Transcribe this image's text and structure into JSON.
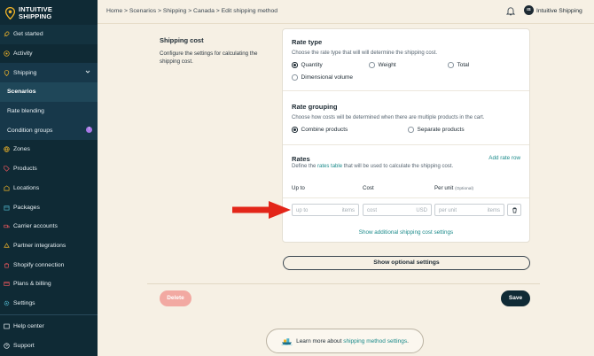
{
  "brand": {
    "line1": "INTUITIVE",
    "line2": "SHIPPING"
  },
  "sidebar": {
    "items": [
      {
        "label": "Get started",
        "icon": "rocket-icon"
      },
      {
        "label": "Activity",
        "icon": "activity-icon"
      },
      {
        "label": "Shipping",
        "icon": "shipping-icon",
        "chevron": "chevron-down-icon"
      },
      {
        "label": "Scenarios"
      },
      {
        "label": "Rate blending"
      },
      {
        "label": "Condition groups",
        "badge": "!"
      },
      {
        "label": "Zones",
        "icon": "globe-icon"
      },
      {
        "label": "Products",
        "icon": "tag-icon"
      },
      {
        "label": "Locations",
        "icon": "location-icon"
      },
      {
        "label": "Packages",
        "icon": "box-icon"
      },
      {
        "label": "Carrier accounts",
        "icon": "carrier-icon"
      },
      {
        "label": "Partner integrations",
        "icon": "integration-icon"
      },
      {
        "label": "Shopify connection",
        "icon": "shopify-icon"
      },
      {
        "label": "Plans & billing",
        "icon": "card-icon"
      },
      {
        "label": "Settings",
        "icon": "gear-icon"
      }
    ],
    "bottom": [
      {
        "label": "Help center",
        "icon": "help-icon"
      },
      {
        "label": "Support",
        "icon": "support-icon"
      }
    ]
  },
  "topbar": {
    "breadcrumb": "Home > Scenarios > Shipping > Canada > Edit shipping method",
    "user_initials": "IS",
    "user_name": "Intuitive Shipping"
  },
  "section": {
    "title": "Shipping cost",
    "description": "Configure the settings for calculating the shipping cost."
  },
  "rate_type": {
    "title": "Rate type",
    "subtitle": "Choose the rate type that will will determine the shipping cost.",
    "options": [
      "Quantity",
      "Weight",
      "Total",
      "Dimensional volume"
    ],
    "selected": "Quantity"
  },
  "rate_grouping": {
    "title": "Rate grouping",
    "subtitle": "Choose how costs will be determined when there are multiple products in the cart.",
    "options": [
      "Combine products",
      "Separate products"
    ],
    "selected": "Combine products"
  },
  "rates": {
    "title": "Rates",
    "add_link": "Add rate row",
    "desc_before": "Define the",
    "desc_link": "rates table",
    "desc_after": "that will be used to calculate the shipping cost.",
    "columns": {
      "up_to": "Up to",
      "cost": "Cost",
      "per_unit": "Per unit",
      "optional": "(Optional)"
    },
    "row": {
      "up_to_placeholder": "up to",
      "up_to_unit": "items",
      "cost_placeholder": "cost",
      "cost_unit": "USD",
      "per_unit_placeholder": "per unit",
      "per_unit_unit": "items"
    },
    "additional_link": "Show additional shipping cost settings"
  },
  "buttons": {
    "optional": "Show optional settings",
    "delete": "Delete",
    "save": "Save"
  },
  "learn": {
    "before": "Learn more about",
    "link": "shipping method settings",
    "after": "."
  },
  "colors": {
    "sidebar_bg": "#0f2a35",
    "page_bg": "#f6f0e4",
    "accent_link": "#1a8a8a",
    "icon_yellow": "#f0b429",
    "delete_bg": "#f2a9a2",
    "arrow_red": "#e32619"
  }
}
